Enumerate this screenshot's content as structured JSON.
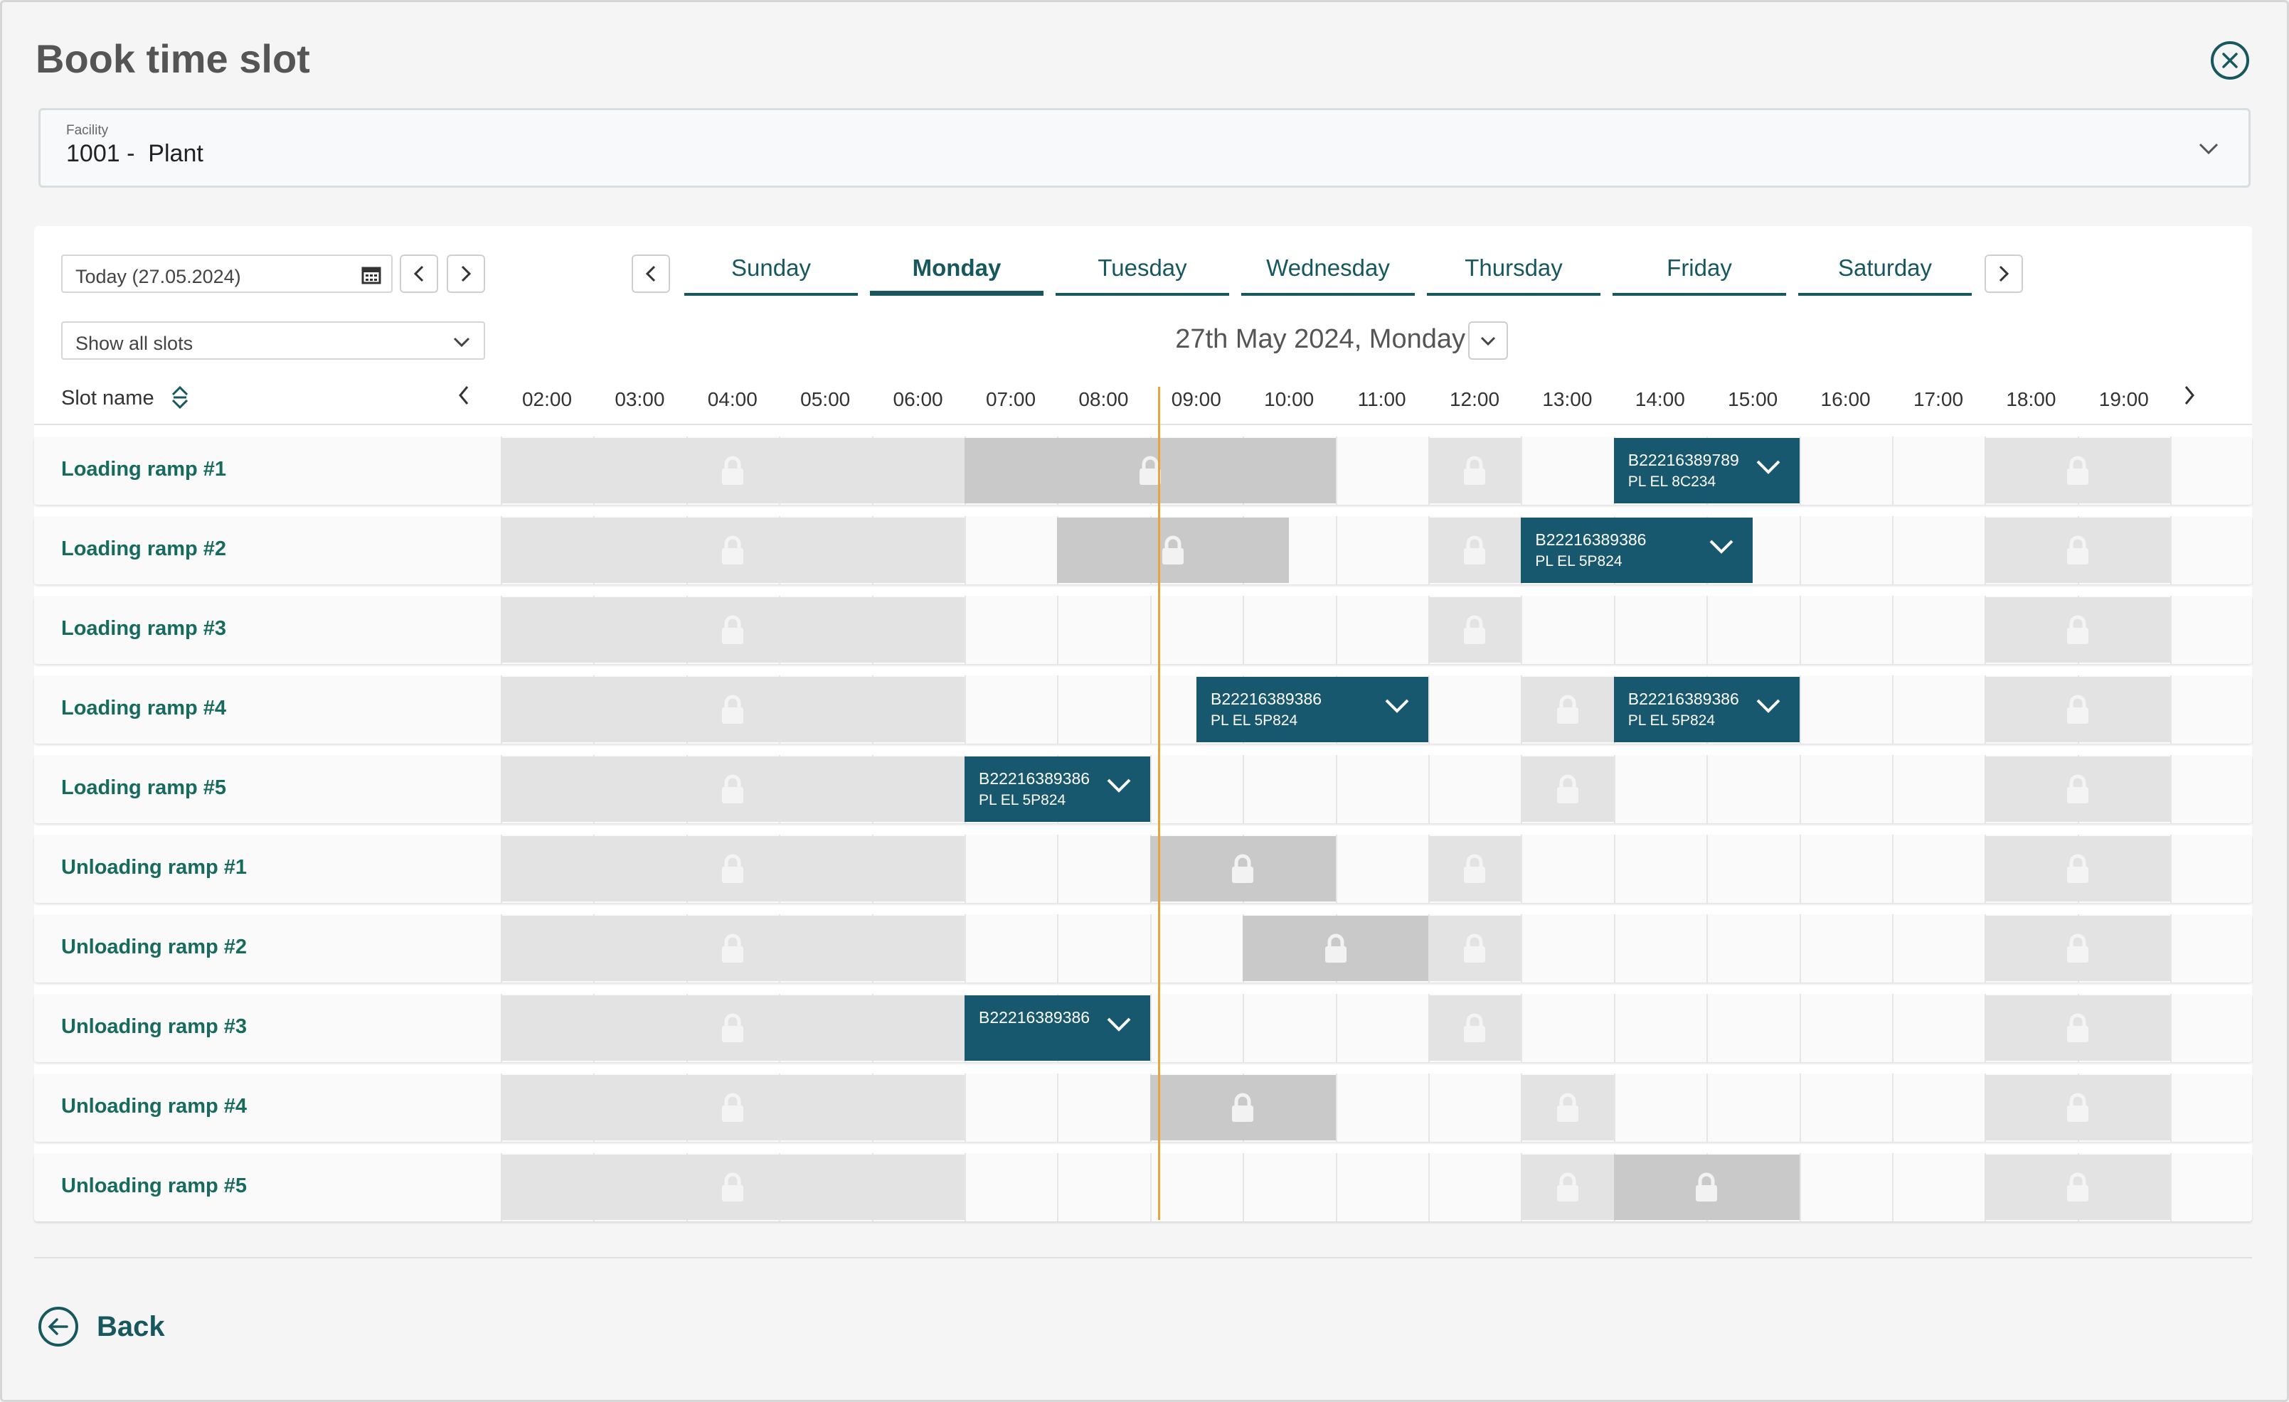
{
  "page": {
    "title": "Book time slot"
  },
  "facility": {
    "label": "Facility",
    "value": "1001 -  Plant"
  },
  "date_picker": {
    "value": "Today (27.05.2024)"
  },
  "filter": {
    "value": "Show all slots"
  },
  "days": [
    {
      "label": "Sunday",
      "active": false
    },
    {
      "label": "Monday",
      "active": true
    },
    {
      "label": "Tuesday",
      "active": false
    },
    {
      "label": "Wednesday",
      "active": false
    },
    {
      "label": "Thursday",
      "active": false
    },
    {
      "label": "Friday",
      "active": false
    },
    {
      "label": "Saturday",
      "active": false
    }
  ],
  "selected_date": "27th May 2024, Monday",
  "schedule": {
    "slot_header": "Slot name",
    "hours": [
      "02:00",
      "03:00",
      "04:00",
      "05:00",
      "06:00",
      "07:00",
      "08:00",
      "09:00",
      "10:00",
      "11:00",
      "12:00",
      "13:00",
      "14:00",
      "15:00",
      "16:00",
      "17:00",
      "18:00",
      "19:00"
    ],
    "rows": [
      {
        "name": "Loading ramp #1",
        "blocked": [
          {
            "from": "02:00",
            "to": "07:00",
            "shade": "light"
          },
          {
            "from": "07:00",
            "to": "11:00",
            "shade": "dark"
          },
          {
            "from": "12:00",
            "to": "13:00",
            "shade": "light"
          },
          {
            "from": "18:00",
            "to": "20:00",
            "shade": "light"
          }
        ],
        "bookings": [
          {
            "from": "14:00",
            "to": "16:00",
            "id": "B22216389789",
            "plate": "PL EL 8C234"
          }
        ]
      },
      {
        "name": "Loading ramp #2",
        "blocked": [
          {
            "from": "02:00",
            "to": "07:00",
            "shade": "light"
          },
          {
            "from": "08:00",
            "to": "10:30",
            "shade": "dark"
          },
          {
            "from": "12:00",
            "to": "13:00",
            "shade": "light"
          },
          {
            "from": "18:00",
            "to": "20:00",
            "shade": "light"
          }
        ],
        "bookings": [
          {
            "from": "13:00",
            "to": "15:30",
            "id": "B22216389386",
            "plate": "PL EL 5P824"
          }
        ]
      },
      {
        "name": "Loading ramp #3",
        "blocked": [
          {
            "from": "02:00",
            "to": "07:00",
            "shade": "light"
          },
          {
            "from": "12:00",
            "to": "13:00",
            "shade": "light"
          },
          {
            "from": "18:00",
            "to": "20:00",
            "shade": "light"
          }
        ],
        "bookings": []
      },
      {
        "name": "Loading ramp #4",
        "blocked": [
          {
            "from": "02:00",
            "to": "07:00",
            "shade": "light"
          },
          {
            "from": "13:00",
            "to": "14:00",
            "shade": "light"
          },
          {
            "from": "18:00",
            "to": "20:00",
            "shade": "light"
          }
        ],
        "bookings": [
          {
            "from": "09:30",
            "to": "12:00",
            "id": "B22216389386",
            "plate": "PL EL 5P824"
          },
          {
            "from": "14:00",
            "to": "16:00",
            "id": "B22216389386",
            "plate": "PL EL 5P824"
          }
        ]
      },
      {
        "name": "Loading ramp #5",
        "blocked": [
          {
            "from": "02:00",
            "to": "07:00",
            "shade": "light"
          },
          {
            "from": "13:00",
            "to": "14:00",
            "shade": "light"
          },
          {
            "from": "18:00",
            "to": "20:00",
            "shade": "light"
          }
        ],
        "bookings": [
          {
            "from": "07:00",
            "to": "09:00",
            "id": "B22216389386",
            "plate": "PL EL 5P824"
          }
        ]
      },
      {
        "name": "Unloading ramp #1",
        "blocked": [
          {
            "from": "02:00",
            "to": "07:00",
            "shade": "light"
          },
          {
            "from": "09:00",
            "to": "11:00",
            "shade": "dark"
          },
          {
            "from": "12:00",
            "to": "13:00",
            "shade": "light"
          },
          {
            "from": "18:00",
            "to": "20:00",
            "shade": "light"
          }
        ],
        "bookings": []
      },
      {
        "name": "Unloading ramp #2",
        "blocked": [
          {
            "from": "02:00",
            "to": "07:00",
            "shade": "light"
          },
          {
            "from": "10:00",
            "to": "12:00",
            "shade": "dark"
          },
          {
            "from": "12:00",
            "to": "13:00",
            "shade": "light"
          },
          {
            "from": "18:00",
            "to": "20:00",
            "shade": "light"
          }
        ],
        "bookings": []
      },
      {
        "name": "Unloading ramp #3",
        "blocked": [
          {
            "from": "02:00",
            "to": "07:00",
            "shade": "light"
          },
          {
            "from": "12:00",
            "to": "13:00",
            "shade": "light"
          },
          {
            "from": "18:00",
            "to": "20:00",
            "shade": "light"
          }
        ],
        "bookings": [
          {
            "from": "07:00",
            "to": "09:00",
            "id": "B22216389386",
            "plate": ""
          }
        ]
      },
      {
        "name": "Unloading ramp #4",
        "blocked": [
          {
            "from": "02:00",
            "to": "07:00",
            "shade": "light"
          },
          {
            "from": "09:00",
            "to": "11:00",
            "shade": "dark"
          },
          {
            "from": "13:00",
            "to": "14:00",
            "shade": "light"
          },
          {
            "from": "18:00",
            "to": "20:00",
            "shade": "light"
          }
        ],
        "bookings": []
      },
      {
        "name": "Unloading ramp #5",
        "blocked": [
          {
            "from": "02:00",
            "to": "07:00",
            "shade": "light"
          },
          {
            "from": "13:00",
            "to": "14:00",
            "shade": "light"
          },
          {
            "from": "14:00",
            "to": "16:00",
            "shade": "dark"
          },
          {
            "from": "18:00",
            "to": "20:00",
            "shade": "light"
          }
        ],
        "bookings": []
      }
    ]
  },
  "footer": {
    "back_label": "Back"
  },
  "colors": {
    "accent": "#17585f",
    "booking": "#17586f",
    "now_line": "#e8a63a",
    "slot_name": "#176a5e"
  }
}
